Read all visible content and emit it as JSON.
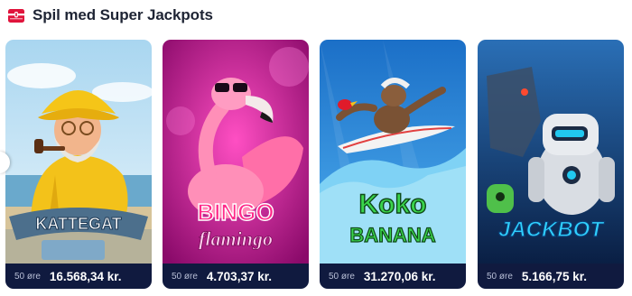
{
  "section": {
    "title": "Spil med Super Jackpots",
    "icon": "jackpot-chest-icon",
    "accent_color": "#e0143c"
  },
  "games": [
    {
      "name": "Kattegat",
      "logo_text": "KATTEGAT",
      "bet": "50 øre",
      "jackpot": "16.568,34 kr."
    },
    {
      "name": "Bingo Flamingo",
      "logo_text_top": "BINGO",
      "logo_text_bottom": "flamingo",
      "bet": "50 øre",
      "jackpot": "4.703,37 kr."
    },
    {
      "name": "Koko Banana",
      "logo_text_top": "Koko",
      "logo_text_bottom": "BANANA",
      "bet": "50 øre",
      "jackpot": "31.270,06 kr."
    },
    {
      "name": "Jackbot",
      "logo_text": "JACKBOT",
      "bet": "50 øre",
      "jackpot": "5.166,75 kr."
    }
  ],
  "colors": {
    "footer_bg": "#101a3f",
    "kattegat_sky": "#bfe0f2",
    "flamingo_bg": "#c4148c",
    "koko_bg": "#2a88d8",
    "jackbot_bg": "#0c2a5c"
  }
}
